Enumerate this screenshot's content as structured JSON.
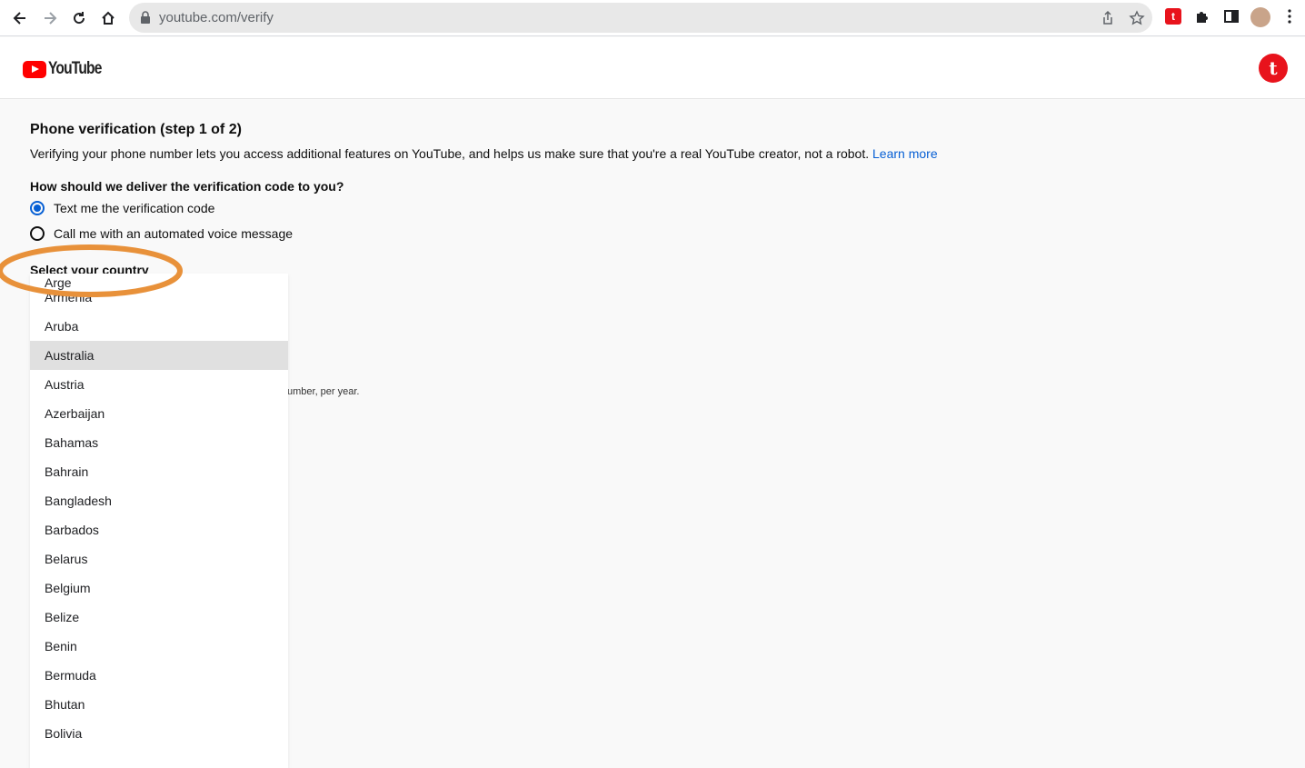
{
  "browser": {
    "url_host": "youtube.com",
    "url_path": "/verify"
  },
  "header": {
    "logo_text": "YouTube",
    "avatar_letter": "t"
  },
  "page": {
    "title": "Phone verification (step 1 of 2)",
    "description": "Verifying your phone number lets you access additional features on YouTube, and helps us make sure that you're a real YouTube creator, not a robot.",
    "learn_more": "Learn more",
    "question": "How should we deliver the verification code to you?",
    "options": [
      {
        "label": "Text me the verification code",
        "checked": true
      },
      {
        "label": "Call me with an automated voice message",
        "checked": false
      }
    ],
    "country_label": "Select your country",
    "hint_fragment": "umber, per year."
  },
  "dropdown": {
    "partial_item": "Arge",
    "items": [
      "Armenia",
      "Aruba",
      "Australia",
      "Austria",
      "Azerbaijan",
      "Bahamas",
      "Bahrain",
      "Bangladesh",
      "Barbados",
      "Belarus",
      "Belgium",
      "Belize",
      "Benin",
      "Bermuda",
      "Bhutan",
      "Bolivia"
    ],
    "highlighted": "Australia"
  },
  "colors": {
    "accent": "#065fd4",
    "annotation": "#e8913a",
    "brand_red": "#ff0000"
  }
}
